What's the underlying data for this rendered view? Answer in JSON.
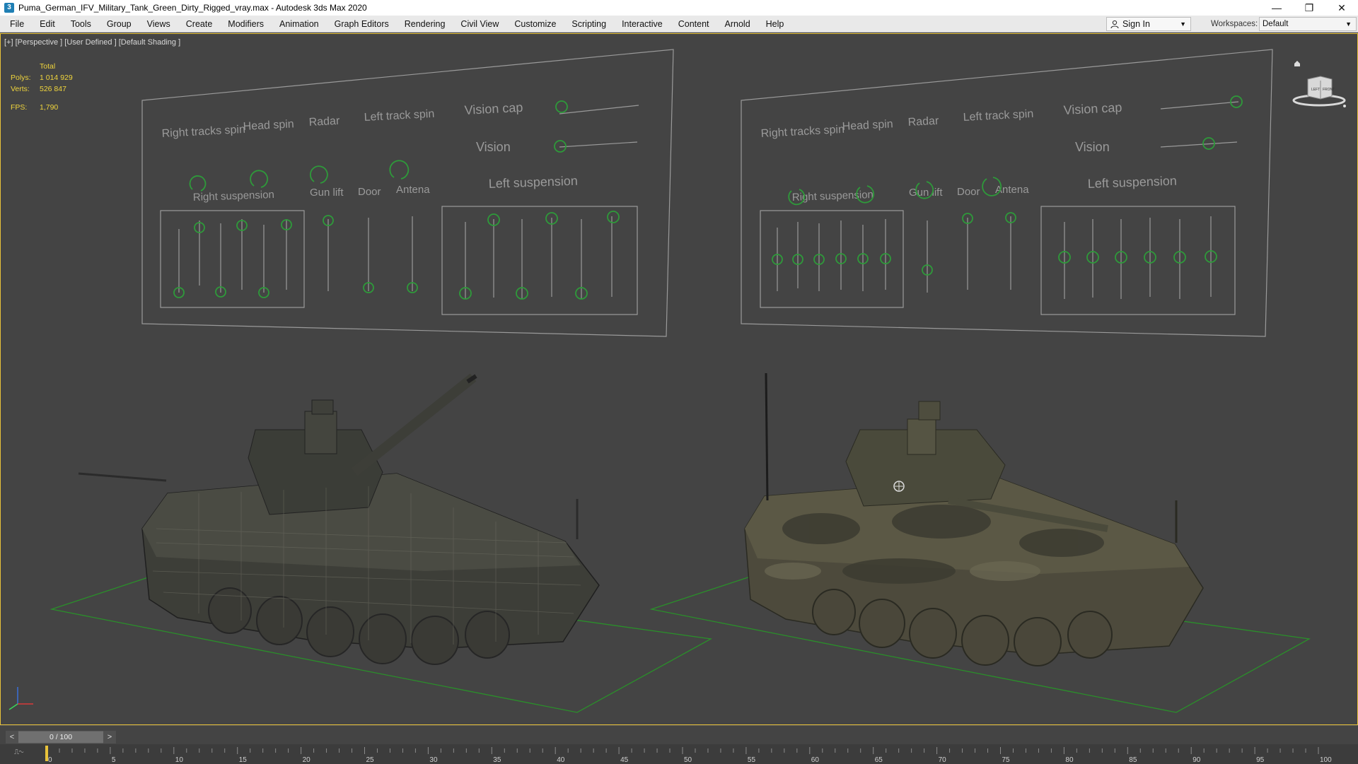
{
  "window": {
    "title": "Puma_German_IFV_Military_Tank_Green_Dirty_Rigged_vray.max - Autodesk 3ds Max 2020",
    "minimize": "—",
    "restore": "❐",
    "close": "✕"
  },
  "menu": [
    "File",
    "Edit",
    "Tools",
    "Group",
    "Views",
    "Create",
    "Modifiers",
    "Animation",
    "Graph Editors",
    "Rendering",
    "Civil View",
    "Customize",
    "Scripting",
    "Interactive",
    "Content",
    "Arnold",
    "Help"
  ],
  "signin": {
    "label": "Sign In"
  },
  "workspaces": {
    "label": "Workspaces:",
    "value": "Default"
  },
  "viewport": {
    "label": "[+] [Perspective ] [User Defined ] [Default Shading ]",
    "stats": {
      "header": "Total",
      "polys_label": "Polys:",
      "polys": "1 014 929",
      "verts_label": "Verts:",
      "verts": "526 847",
      "fps_label": "FPS:",
      "fps": "1,790"
    },
    "viewcube": {
      "left": "LEFT",
      "front": "FRONT"
    }
  },
  "panels": [
    {
      "labels": {
        "right_tracks_spin": "Right tracks spin",
        "head_spin": "Head spin",
        "radar": "Radar",
        "left_track_spin": "Left track spin",
        "vision_cap": "Vision cap",
        "vision": "Vision",
        "right_suspension": "Right suspension",
        "gun_lift": "Gun lift",
        "door": "Door",
        "antena": "Antena",
        "left_suspension": "Left suspension"
      }
    },
    {
      "labels": {
        "right_tracks_spin": "Right tracks spin",
        "head_spin": "Head spin",
        "radar": "Radar",
        "left_track_spin": "Left track spin",
        "vision_cap": "Vision cap",
        "vision": "Vision",
        "right_suspension": "Right suspension",
        "gun_lift": "Gun lift",
        "door": "Door",
        "antena": "Antena",
        "left_suspension": "Left suspension"
      }
    }
  ],
  "timeline": {
    "slider": "0 / 100",
    "prev": "<",
    "next": ">",
    "ticks": [
      "0",
      "5",
      "10",
      "15",
      "20",
      "25",
      "30",
      "35",
      "40",
      "45",
      "50",
      "55",
      "60",
      "65",
      "70",
      "75",
      "80",
      "85",
      "90",
      "95",
      "100"
    ],
    "current_frame": 0
  },
  "colors": {
    "viewport_bg": "#444444",
    "stats": "#f0d53c",
    "control": "#2e9a3a",
    "ground": "#2a8f2a",
    "panel_line": "#9a9a9a"
  }
}
